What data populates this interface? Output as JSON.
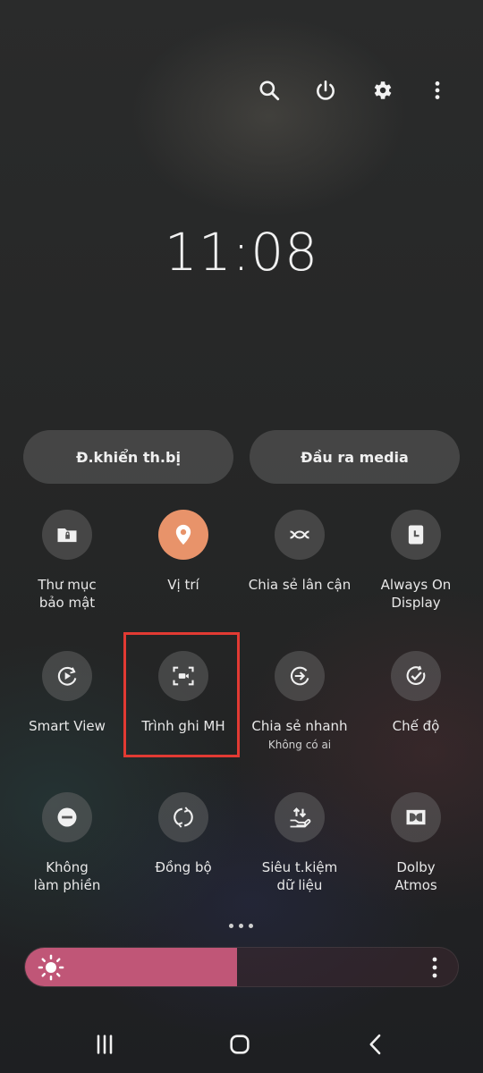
{
  "clock": {
    "time": "11:08"
  },
  "top_actions": [
    {
      "name": "search",
      "icon": "search-icon"
    },
    {
      "name": "power",
      "icon": "power-icon"
    },
    {
      "name": "settings",
      "icon": "gear-icon"
    },
    {
      "name": "more",
      "icon": "more-vertical-icon"
    }
  ],
  "buttons": {
    "device_control": "Đ.khiển th.bị",
    "media_output": "Đầu ra media"
  },
  "tiles": {
    "secure_folder": {
      "label": "Thư mục\nbảo mật",
      "icon": "secure-folder-icon",
      "active": false
    },
    "location": {
      "label": "Vị trí",
      "icon": "location-pin-icon",
      "active": true
    },
    "nearby_share": {
      "label": "Chia sẻ lân cận",
      "icon": "nearby-share-icon",
      "active": false
    },
    "always_on_display": {
      "label": "Always On\nDisplay",
      "icon": "clock-display-icon",
      "active": false
    },
    "smart_view": {
      "label": "Smart View",
      "icon": "smart-view-icon",
      "active": false
    },
    "screen_recorder": {
      "label": "Trình ghi MH",
      "icon": "screen-recorder-icon",
      "active": false
    },
    "quick_share": {
      "label": "Chia sẻ nhanh",
      "sub": "Không có ai",
      "icon": "quick-share-icon",
      "active": false
    },
    "modes": {
      "label": "Chế độ",
      "icon": "modes-check-icon",
      "active": false
    },
    "do_not_disturb": {
      "label": "Không\nlàm phiền",
      "icon": "minus-circle-icon",
      "active": false
    },
    "sync": {
      "label": "Đồng bộ",
      "icon": "sync-icon",
      "active": false
    },
    "data_saver": {
      "label": "Siêu t.kiệm\ndữ liệu",
      "icon": "data-saver-icon",
      "active": false
    },
    "dolby_atmos": {
      "label": "Dolby\nAtmos",
      "icon": "dolby-icon",
      "active": false
    }
  },
  "brightness": {
    "level_percent": 49
  },
  "colors": {
    "active_tile": "#e8936a",
    "brightness_fill": "#c05677",
    "highlight_box": "#e23a33"
  },
  "nav": [
    {
      "name": "recent-apps",
      "icon": "recents-icon"
    },
    {
      "name": "home",
      "icon": "home-icon"
    },
    {
      "name": "back",
      "icon": "back-icon"
    }
  ]
}
